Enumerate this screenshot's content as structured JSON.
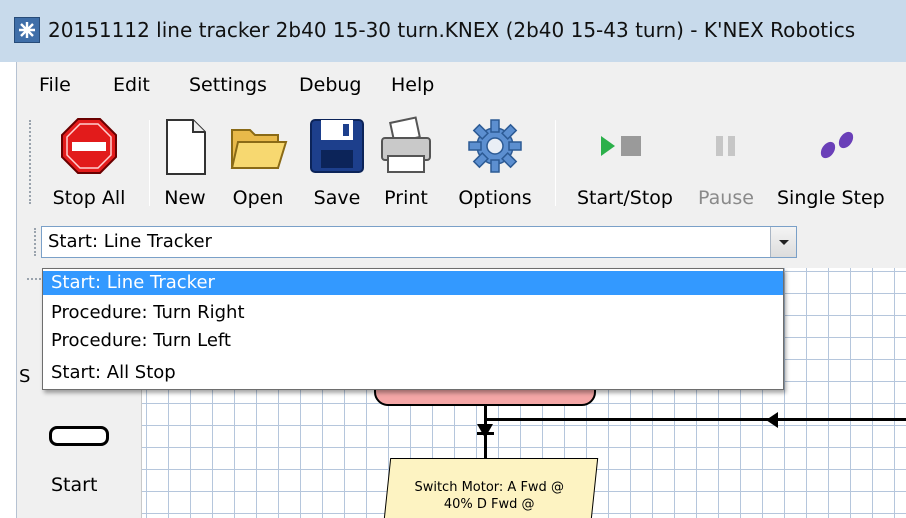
{
  "window": {
    "title": "20151112 line tracker 2b40 15-30 turn.KNEX (2b40 15-43 turn)  - K'NEX Robotics"
  },
  "menu": {
    "items": [
      "File",
      "Edit",
      "Settings",
      "Debug",
      "Help"
    ]
  },
  "toolbar": {
    "stop_all": "Stop All",
    "new": "New",
    "open": "Open",
    "save": "Save",
    "print": "Print",
    "options": "Options",
    "start_stop": "Start/Stop",
    "pause": "Pause",
    "single_step": "Single Step"
  },
  "program_select": {
    "value": "Start: Line Tracker",
    "options": [
      "Start: Line Tracker",
      "Procedure: Turn Right",
      "Procedure: Turn Left",
      "Start: All Stop"
    ]
  },
  "palette": {
    "peek_label": "S",
    "start_label": "Start"
  },
  "canvas": {
    "motor_block_text": "Switch Motor: A Fwd @ 40% D Fwd @"
  },
  "colors": {
    "titlebar": "#c8daeb",
    "selection": "#3399ff",
    "start_block": "#f4a6a6",
    "motor_block": "#fdf3c2",
    "grid": "#b5c6dc"
  },
  "icons": [
    "app-icon",
    "stop-sign-icon",
    "new-file-icon",
    "open-folder-icon",
    "save-disk-icon",
    "printer-icon",
    "gear-icon",
    "play-stop-icon",
    "pause-icon",
    "footsteps-icon",
    "dropdown-arrow-icon"
  ]
}
